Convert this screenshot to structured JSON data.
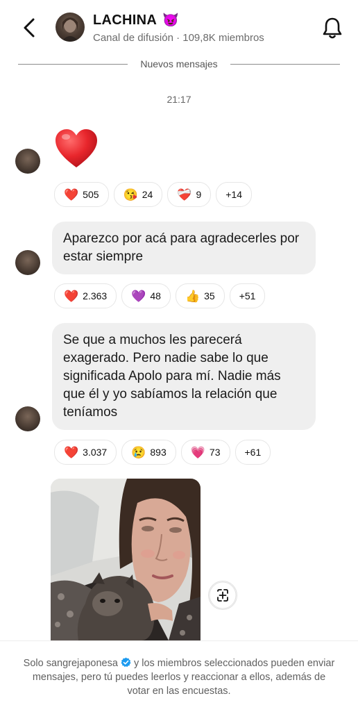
{
  "header": {
    "channel_name": "LACHINA",
    "channel_emoji": "😈",
    "subtitle": "Canal de difusión · 109,8K miembros"
  },
  "divider_label": "Nuevos mensajes",
  "timestamp": "21:17",
  "messages": [
    {
      "type": "emoji",
      "content": "❤️",
      "reactions": [
        {
          "emoji": "❤️",
          "count": "505"
        },
        {
          "emoji": "😘",
          "count": "24"
        },
        {
          "emoji": "❤️‍🩹",
          "count": "9"
        },
        {
          "more": "+14"
        }
      ]
    },
    {
      "type": "text",
      "text": "Aparezco por acá para agradecerles por estar siempre",
      "reactions": [
        {
          "emoji": "❤️",
          "count": "2.363"
        },
        {
          "emoji": "💜",
          "count": "48"
        },
        {
          "emoji": "👍",
          "count": "35"
        },
        {
          "more": "+51"
        }
      ]
    },
    {
      "type": "text",
      "text": "Se que a muchos les parecerá exagerado. Pero nadie sabe lo que significada Apolo para mí. Nadie más que él y yo sabíamos la relación que teníamos",
      "reactions": [
        {
          "emoji": "❤️",
          "count": "3.037"
        },
        {
          "emoji": "😢",
          "count": "893"
        },
        {
          "emoji": "💗",
          "count": "73"
        },
        {
          "more": "+61"
        }
      ]
    },
    {
      "type": "photo"
    }
  ],
  "footer": {
    "part1": "Solo sangrejaponesa",
    "part2": " y los miembros seleccionados pueden enviar mensajes, pero tú puedes leerlos y reaccionar a ellos, además de votar en las encuestas."
  },
  "colors": {
    "bubble": "#efefef",
    "verified": "#1d9bf0",
    "heart": "#e8262c"
  }
}
